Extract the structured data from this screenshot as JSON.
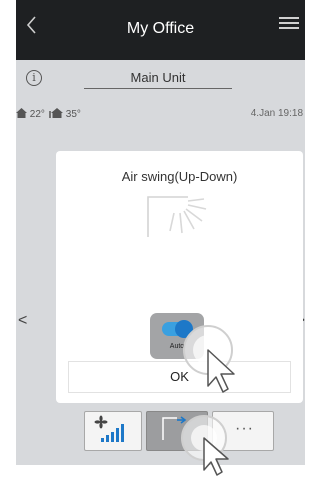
{
  "header": {
    "title": "My Office"
  },
  "unit": {
    "name": "Main Unit"
  },
  "temperatures": {
    "indoor": "22°",
    "outdoor": "35°"
  },
  "datetime": "4.Jan 19:18",
  "navigation": {
    "prev_glyph": "<",
    "next_glyph": ">"
  },
  "dialog": {
    "title": "Air swing(Up-Down)",
    "auto_label": "Auto",
    "auto_enabled": true,
    "ok_label": "OK"
  },
  "bottom_controls": {
    "more_label": "···"
  },
  "colors": {
    "header_bg": "#1e2022",
    "toggle_on": "#3aa0e0",
    "accent_blue": "#1d78c8"
  }
}
